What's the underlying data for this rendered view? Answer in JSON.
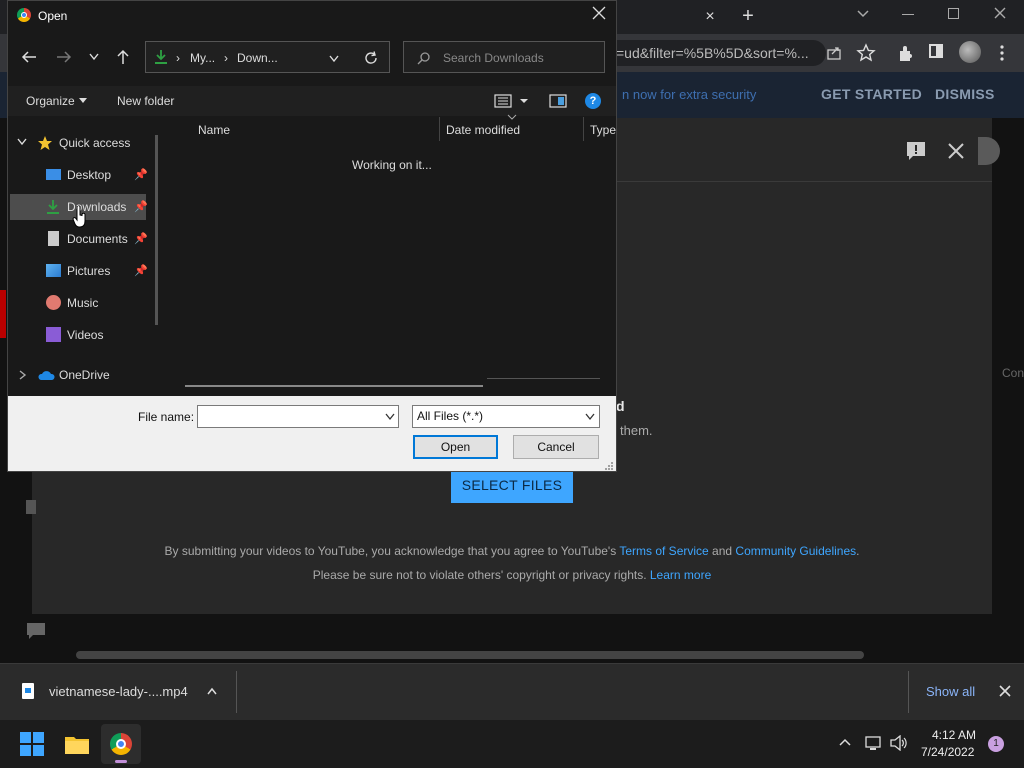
{
  "browser": {
    "omnibox_text": "=ud&filter=%5B%5D&sort=%...",
    "tab_close": "×",
    "new_tab": "+"
  },
  "youtube": {
    "promo_text": "n now for extra security",
    "get_started": "GET STARTED",
    "dismiss": "DISMISS",
    "upload_title_tail": "d",
    "upload_sub_tail": "them.",
    "select_files": "SELECT FILES",
    "terms_prefix": "By submitting your videos to YouTube, you acknowledge that you agree to YouTube's ",
    "terms_link": "Terms of Service",
    "terms_and": " and ",
    "guidelines_link": "Community Guidelines",
    "terms_suffix": ".",
    "copyright_text": "Please be sure not to violate others' copyright or privacy rights. ",
    "learn_more": "Learn more",
    "side_text": "Con"
  },
  "dialog": {
    "title": "Open",
    "breadcrumb": [
      "My...",
      "Down..."
    ],
    "search_placeholder": "Search Downloads",
    "organize": "Organize",
    "new_folder": "New folder",
    "nav": {
      "quick_access": "Quick access",
      "items": [
        "Desktop",
        "Downloads",
        "Documents",
        "Pictures",
        "Music",
        "Videos"
      ],
      "onedrive": "OneDrive"
    },
    "columns": [
      "Name",
      "Date modified",
      "Type"
    ],
    "status": "Working on it...",
    "file_name_label": "File name:",
    "file_name_value": "",
    "filter": "All Files (*.*)",
    "open_btn": "Open",
    "cancel_btn": "Cancel"
  },
  "downloads": {
    "file_name": "vietnamese-lady-....mp4",
    "show_all": "Show all"
  },
  "taskbar": {
    "time": "4:12 AM",
    "date": "7/24/2022",
    "notification_count": "1"
  }
}
